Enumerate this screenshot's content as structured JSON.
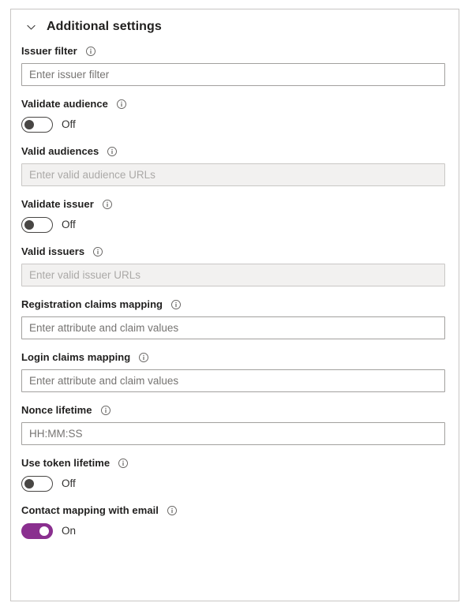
{
  "panel": {
    "header": {
      "title": "Additional settings",
      "chevron_icon": "chevron-down-icon",
      "expanded": true
    },
    "info_icon": "info-circle-icon",
    "toggle_on_color": "#8a2f8f",
    "toggle_off_color": "#484644",
    "fields": [
      {
        "type": "text",
        "name": "issuer-filter",
        "label": "Issuer filter",
        "placeholder": "Enter issuer filter",
        "value": "",
        "disabled": false,
        "has_info": true
      },
      {
        "type": "toggle",
        "name": "validate-audience",
        "label": "Validate audience",
        "state": "Off",
        "checked": false,
        "has_info": true
      },
      {
        "type": "text",
        "name": "valid-audiences",
        "label": "Valid audiences",
        "placeholder": "Enter valid audience URLs",
        "value": "",
        "disabled": true,
        "has_info": true
      },
      {
        "type": "toggle",
        "name": "validate-issuer",
        "label": "Validate issuer",
        "state": "Off",
        "checked": false,
        "has_info": true
      },
      {
        "type": "text",
        "name": "valid-issuers",
        "label": "Valid issuers",
        "placeholder": "Enter valid issuer URLs",
        "value": "",
        "disabled": true,
        "has_info": true
      },
      {
        "type": "text",
        "name": "registration-claims-mapping",
        "label": "Registration claims mapping",
        "placeholder": "Enter attribute and claim values",
        "value": "",
        "disabled": false,
        "has_info": true
      },
      {
        "type": "text",
        "name": "login-claims-mapping",
        "label": "Login claims mapping",
        "placeholder": "Enter attribute and claim values",
        "value": "",
        "disabled": false,
        "has_info": true
      },
      {
        "type": "text",
        "name": "nonce-lifetime",
        "label": "Nonce lifetime",
        "placeholder": "HH:MM:SS",
        "value": "",
        "disabled": false,
        "has_info": true
      },
      {
        "type": "toggle",
        "name": "use-token-lifetime",
        "label": "Use token lifetime",
        "state": "Off",
        "checked": false,
        "has_info": true
      },
      {
        "type": "toggle",
        "name": "contact-mapping-with-email",
        "label": "Contact mapping with email",
        "state": "On",
        "checked": true,
        "has_info": true
      }
    ]
  }
}
